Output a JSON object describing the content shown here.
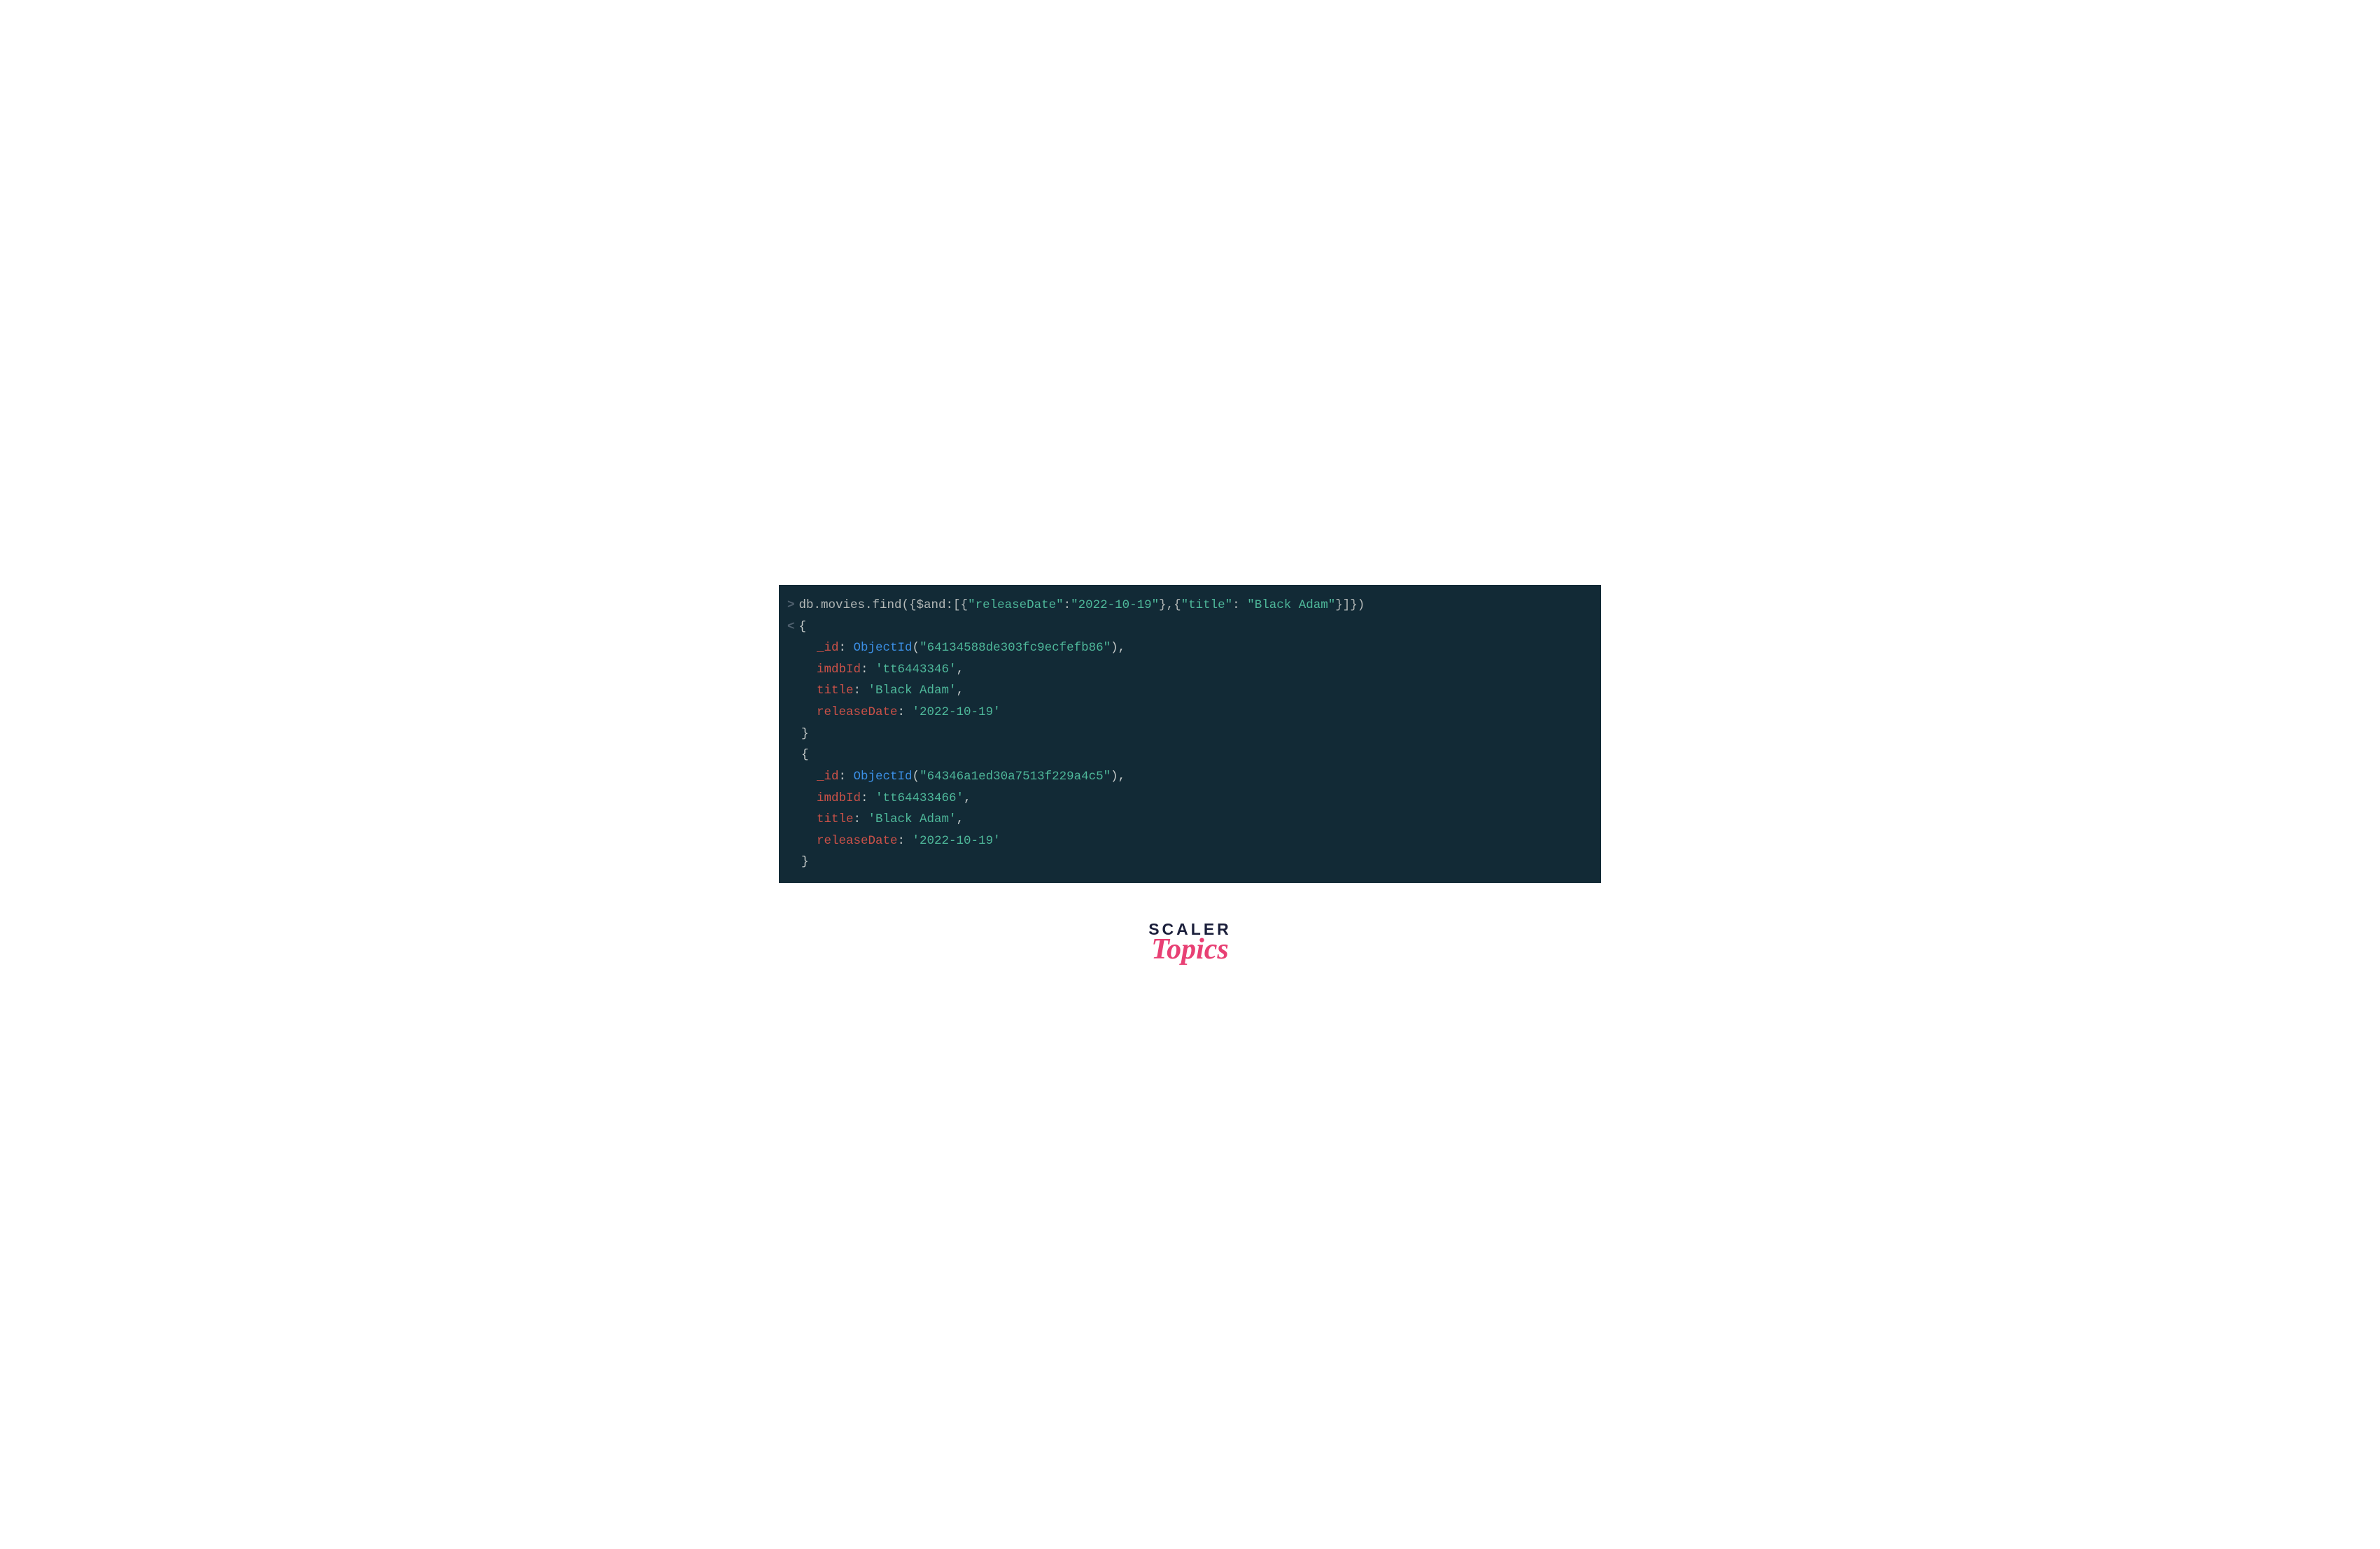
{
  "shell": {
    "prompt_glyph": ">",
    "output_glyph": "<",
    "query_parts": {
      "p1": "db.movies.find({$and:[{",
      "p2": "\"releaseDate\"",
      "p3": ":",
      "p4": "\"2022-10-19\"",
      "p5": "},{",
      "p6": "\"title\"",
      "p7": ": ",
      "p8": "\"Black Adam\"",
      "p9": "}]})"
    },
    "results": [
      {
        "open": "{",
        "id_key": "_id",
        "objectid": "ObjectId",
        "id_val": "\"64134588de303fc9ecfefb86\"",
        "imdb_key": "imdbId",
        "imdb_val": "'tt6443346'",
        "title_key": "title",
        "title_val": "'Black Adam'",
        "date_key": "releaseDate",
        "date_val": "'2022-10-19'",
        "close": "}"
      },
      {
        "open": "{",
        "id_key": "_id",
        "objectid": "ObjectId",
        "id_val": "\"64346a1ed30a7513f229a4c5\"",
        "imdb_key": "imdbId",
        "imdb_val": "'tt64433466'",
        "title_key": "title",
        "title_val": "'Black Adam'",
        "date_key": "releaseDate",
        "date_val": "'2022-10-19'",
        "close": "}"
      }
    ]
  },
  "logo": {
    "line1": "SCALER",
    "line2": "Topics"
  },
  "glyphs": {
    "colon_space": ": ",
    "comma": ",",
    "open_paren": "(",
    "close_paren": ")"
  }
}
